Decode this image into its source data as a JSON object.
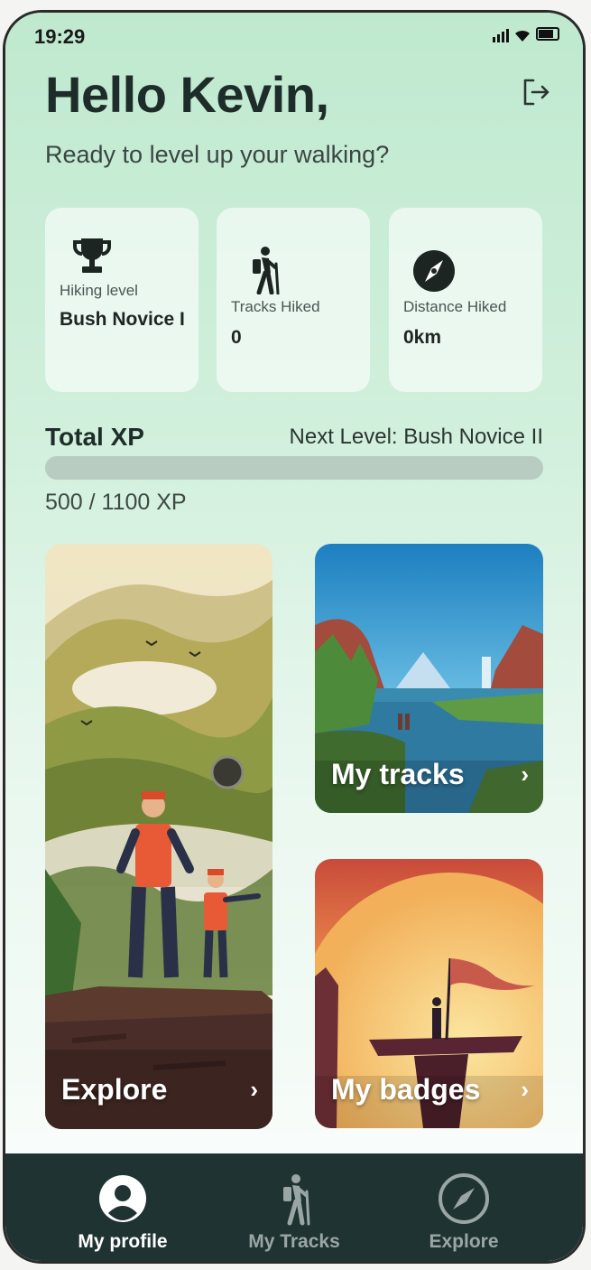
{
  "status": {
    "time": "19:29"
  },
  "header": {
    "greeting": "Hello Kevin,",
    "subtitle": "Ready to level up your walking?"
  },
  "stats": [
    {
      "icon": "trophy-icon",
      "label": "Hiking level",
      "value": "Bush Novice I"
    },
    {
      "icon": "hiker-icon",
      "label": "Tracks Hiked",
      "value": "0"
    },
    {
      "icon": "compass-icon",
      "label": "Distance Hiked",
      "value": "0km"
    }
  ],
  "xp": {
    "title": "Total XP",
    "next_level": "Next Level: Bush Novice II",
    "count_text": "500 / 1100 XP",
    "current": 500,
    "max": 1100
  },
  "tiles": {
    "explore": "Explore",
    "tracks": "My tracks",
    "badges": "My badges"
  },
  "nav": [
    {
      "label": "My profile",
      "icon": "profile-icon",
      "active": true
    },
    {
      "label": "My Tracks",
      "icon": "hiker-icon",
      "active": false
    },
    {
      "label": "Explore",
      "icon": "compass-icon",
      "active": false
    }
  ],
  "colors": {
    "nav_bg": "#1f3333",
    "nav_active": "#ffffff",
    "nav_inactive": "#9aa6a4",
    "accent": "#1f2d2a"
  }
}
